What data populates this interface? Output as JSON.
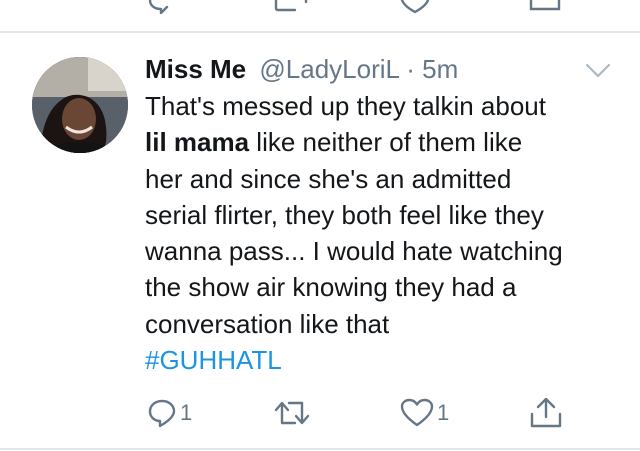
{
  "tweet": {
    "display_name": "Miss Me",
    "handle": "@LadyLoriL",
    "separator": "·",
    "timestamp": "5m",
    "text_lines": [
      {
        "pre": "That's messed up they talkin about",
        "bold": "",
        "post": ""
      },
      {
        "pre": "",
        "bold": "lil mama",
        "post": " like neither of them like"
      },
      {
        "pre": "her and since she's an admitted",
        "bold": "",
        "post": ""
      },
      {
        "pre": "serial flirter, they both feel like they",
        "bold": "",
        "post": ""
      },
      {
        "pre": "wanna pass... I would hate watching",
        "bold": "",
        "post": ""
      },
      {
        "pre": "the show air knowing they had a",
        "bold": "",
        "post": ""
      },
      {
        "pre": "conversation like that",
        "bold": "",
        "post": ""
      }
    ],
    "hashtag": "#GUHHATL",
    "actions": {
      "reply": {
        "icon": "reply-icon",
        "count": "1"
      },
      "retweet": {
        "icon": "retweet-icon",
        "count": ""
      },
      "like": {
        "icon": "heart-icon",
        "count": "1"
      },
      "share": {
        "icon": "share-icon"
      }
    },
    "colors": {
      "text": "#14171a",
      "secondary": "#657786",
      "link": "#1b95e0",
      "divider": "#e1e8ed"
    }
  }
}
